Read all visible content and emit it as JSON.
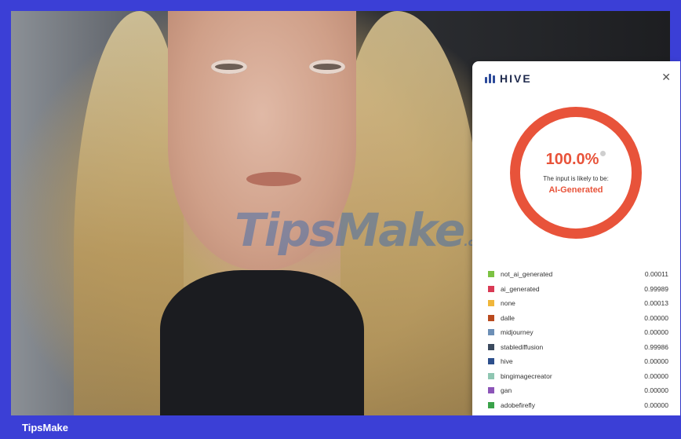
{
  "panel": {
    "brand": "HIVE",
    "close_icon": "close-icon",
    "percent": "100.0%",
    "likely_text": "The input is likely to be:",
    "verdict": "AI-Generated",
    "ring_color": "#e8533a",
    "rows": [
      {
        "label": "not_ai_generated",
        "value": "0.00011",
        "color": "#7cc243"
      },
      {
        "label": "ai_generated",
        "value": "0.99989",
        "color": "#d93a55"
      },
      {
        "label": "none",
        "value": "0.00013",
        "color": "#f0b63b"
      },
      {
        "label": "dalle",
        "value": "0.00000",
        "color": "#b94a1e"
      },
      {
        "label": "midjourney",
        "value": "0.00000",
        "color": "#6d8fb6"
      },
      {
        "label": "stablediffusion",
        "value": "0.99986",
        "color": "#3b4a5e"
      },
      {
        "label": "hive",
        "value": "0.00000",
        "color": "#2d4f8c"
      },
      {
        "label": "bingimagecreator",
        "value": "0.00000",
        "color": "#8fc6b2"
      },
      {
        "label": "gan",
        "value": "0.00000",
        "color": "#8c55b8"
      },
      {
        "label": "adobefirefly",
        "value": "0.00000",
        "color": "#3aa24a"
      }
    ]
  },
  "watermark": {
    "main": "TipsMake",
    "suffix": ".com"
  },
  "footer": {
    "label": "TipsMake"
  }
}
